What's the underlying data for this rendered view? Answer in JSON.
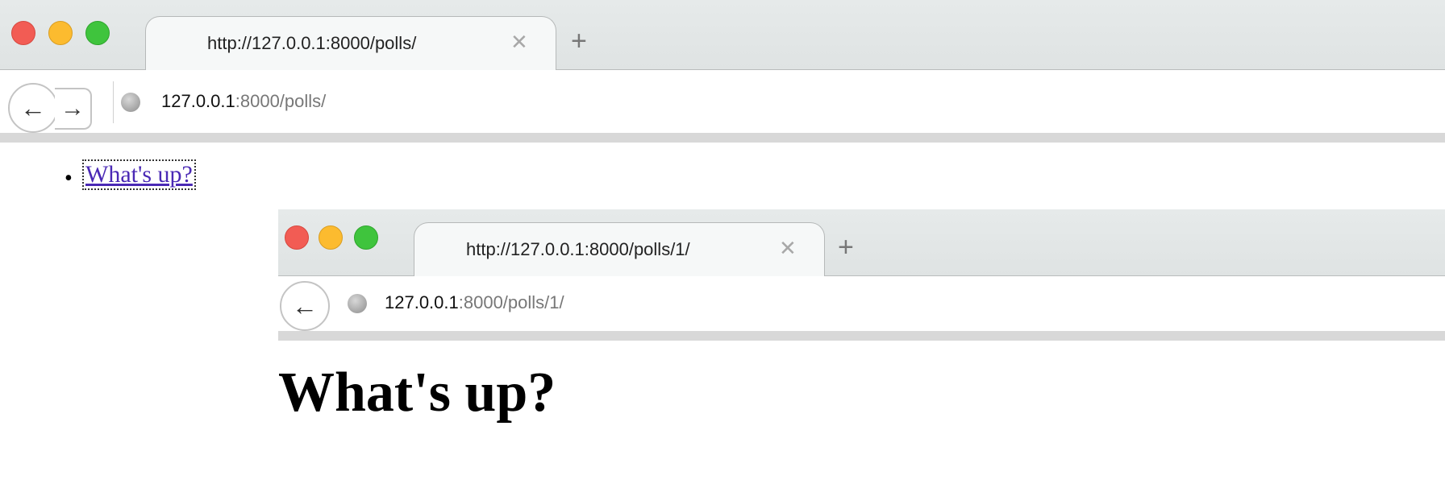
{
  "window_main": {
    "tab_title": "http://127.0.0.1:8000/polls/",
    "tab_close": "✕",
    "new_tab": "+",
    "url_host": "127.0.0.1",
    "url_rest": ":8000/polls/",
    "list_items": [
      "What's up?"
    ]
  },
  "window_detail": {
    "tab_title": "http://127.0.0.1:8000/polls/1/",
    "tab_close": "✕",
    "new_tab": "+",
    "url_host": "127.0.0.1",
    "url_rest": ":8000/polls/1/",
    "heading": "What's up?"
  },
  "icons": {
    "back": "back-arrow-icon",
    "forward": "forward-arrow-icon",
    "globe": "globe-icon"
  },
  "colors": {
    "close": "#f25c54",
    "minimize": "#fcbb2f",
    "zoom": "#3fc43d",
    "link": "#4a29b5"
  }
}
